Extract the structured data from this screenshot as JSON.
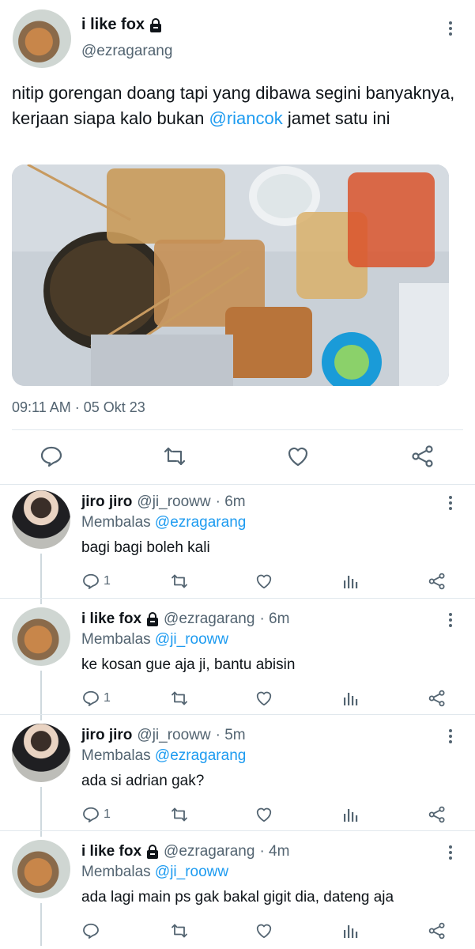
{
  "main": {
    "name": "i like fox",
    "handle": "@ezragarang",
    "text_pre": "nitip gorengan doang tapi yang dibawa segini banyaknya, kerjaan siapa kalo bukan ",
    "mention": "@riancok",
    "text_post": " jamet satu ini",
    "timestamp": "09:11 AM · 05 Okt 23"
  },
  "replies": [
    {
      "name": "jiro jiro",
      "handle": "@ji_rooww",
      "time": "· 6m",
      "reply_prefix": "Membalas ",
      "reply_to": "@ezragarang",
      "text": "bagi bagi boleh kali",
      "reply_count": "1",
      "locked": false
    },
    {
      "name": "i like fox",
      "handle": "@ezragarang",
      "time": "· 6m",
      "reply_prefix": "Membalas ",
      "reply_to": "@ji_rooww",
      "text": "ke kosan gue aja ji, bantu abisin",
      "reply_count": "1",
      "locked": true
    },
    {
      "name": "jiro jiro",
      "handle": "@ji_rooww",
      "time": "· 5m",
      "reply_prefix": "Membalas ",
      "reply_to": "@ezragarang",
      "text": "ada si adrian gak?",
      "reply_count": "1",
      "locked": false
    },
    {
      "name": "i like fox",
      "handle": "@ezragarang",
      "time": "· 4m",
      "reply_prefix": "Membalas ",
      "reply_to": "@ji_rooww",
      "text": "ada lagi main ps gak bakal gigit dia, dateng aja",
      "reply_count": "",
      "locked": true
    }
  ],
  "colors": {
    "accent": "#1d9bf0",
    "muted": "#536471",
    "divider": "#e1e8ed"
  }
}
